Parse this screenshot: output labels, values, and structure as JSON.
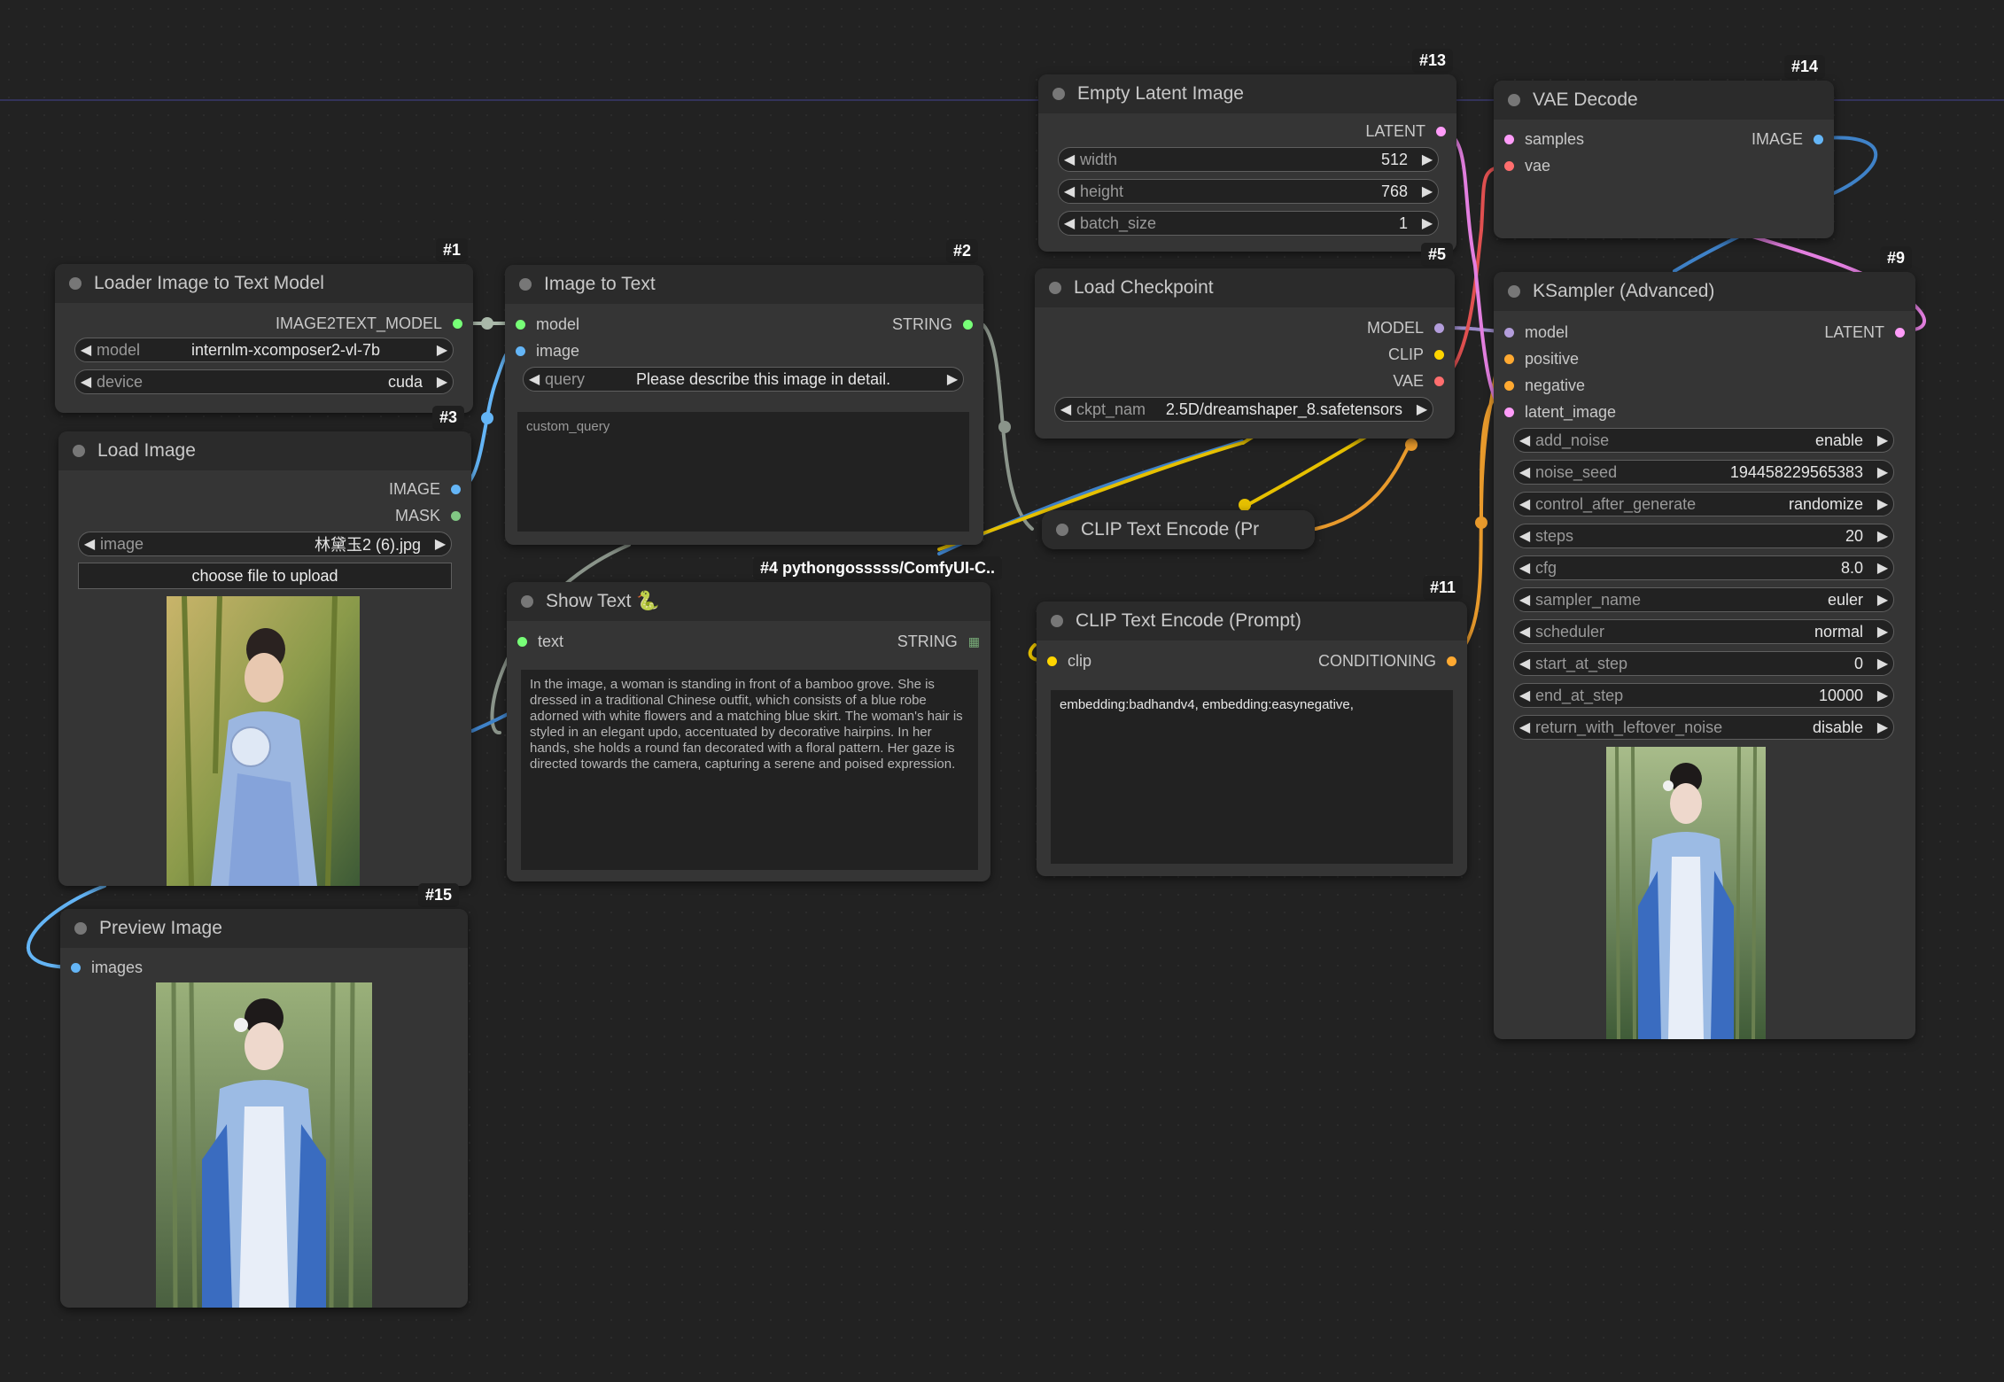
{
  "nodes": {
    "loader": {
      "id": "#1",
      "title": "Loader Image to Text Model",
      "output": "IMAGE2TEXT_MODEL",
      "model_label": "model",
      "model_value": "internlm-xcomposer2-vl-7b",
      "device_label": "device",
      "device_value": "cuda"
    },
    "load_image": {
      "id": "#3",
      "title": "Load Image",
      "out_image": "IMAGE",
      "out_mask": "MASK",
      "image_label": "image",
      "image_value": "林黛玉2 (6).jpg",
      "upload_label": "choose file to upload"
    },
    "preview": {
      "id": "#15",
      "title": "Preview Image",
      "input": "images"
    },
    "image_to_text": {
      "id": "#2",
      "title": "Image to Text",
      "in_model": "model",
      "in_image": "image",
      "output": "STRING",
      "query_label": "query",
      "query_value": "Please describe this image in detail.",
      "custom_placeholder": "custom_query"
    },
    "show_text": {
      "id": "#4 pythongosssss/ComfyUI-C..",
      "title": "Show Text 🐍",
      "in_text": "text",
      "output": "STRING",
      "text": "In the image, a woman is standing in front of a bamboo grove. She is dressed in a traditional Chinese outfit, which consists of a blue robe adorned with white flowers and a matching blue skirt. The woman's hair is styled in an elegant updo, accentuated by decorative hairpins. In her hands, she holds a round fan decorated with a floral pattern. Her gaze is directed towards the camera, capturing a serene and poised expression."
    },
    "empty_latent": {
      "id": "#13",
      "title": "Empty Latent Image",
      "output": "LATENT",
      "width_label": "width",
      "width_value": "512",
      "height_label": "height",
      "height_value": "768",
      "batch_label": "batch_size",
      "batch_value": "1"
    },
    "checkpoint": {
      "id": "#5",
      "title": "Load Checkpoint",
      "out_model": "MODEL",
      "out_clip": "CLIP",
      "out_vae": "VAE",
      "ckpt_label": "ckpt_nam",
      "ckpt_value": "2.5D/dreamshaper_8.safetensors"
    },
    "clip_collapsed": {
      "title": "CLIP Text Encode (Pr"
    },
    "clip_encode": {
      "id": "#11",
      "title": "CLIP Text Encode (Prompt)",
      "in_clip": "clip",
      "output": "CONDITIONING",
      "text": "embedding:badhandv4, embedding:easynegative,"
    },
    "vae_decode": {
      "id": "#14",
      "title": "VAE Decode",
      "in_samples": "samples",
      "in_vae": "vae",
      "output": "IMAGE"
    },
    "ksampler": {
      "id": "#9",
      "title": "KSampler (Advanced)",
      "in_model": "model",
      "in_positive": "positive",
      "in_negative": "negative",
      "in_latent": "latent_image",
      "output": "LATENT",
      "widgets": [
        {
          "label": "add_noise",
          "value": "enable"
        },
        {
          "label": "noise_seed",
          "value": "194458229565383"
        },
        {
          "label": "control_after_generate",
          "value": "randomize"
        },
        {
          "label": "steps",
          "value": "20"
        },
        {
          "label": "cfg",
          "value": "8.0"
        },
        {
          "label": "sampler_name",
          "value": "euler"
        },
        {
          "label": "scheduler",
          "value": "normal"
        },
        {
          "label": "start_at_step",
          "value": "0"
        },
        {
          "label": "end_at_step",
          "value": "10000"
        },
        {
          "label": "return_with_leftover_noise",
          "value": "disable"
        }
      ]
    }
  },
  "colors": {
    "IMAGE": "#64b5f6",
    "MASK": "#81c784",
    "MODEL": "#b39ddb",
    "CLIP": "#ffd500",
    "VAE": "#ff6e6e",
    "LATENT": "#ff9cf9",
    "CONDITIONING": "#ffa931",
    "STRING": "#77ff77",
    "custom": "#aaccaa"
  },
  "icons": {
    "node_dot": "circle-icon",
    "arrow_left": "left-arrow-icon",
    "arrow_right": "right-arrow-icon",
    "grid": "grid-icon"
  }
}
